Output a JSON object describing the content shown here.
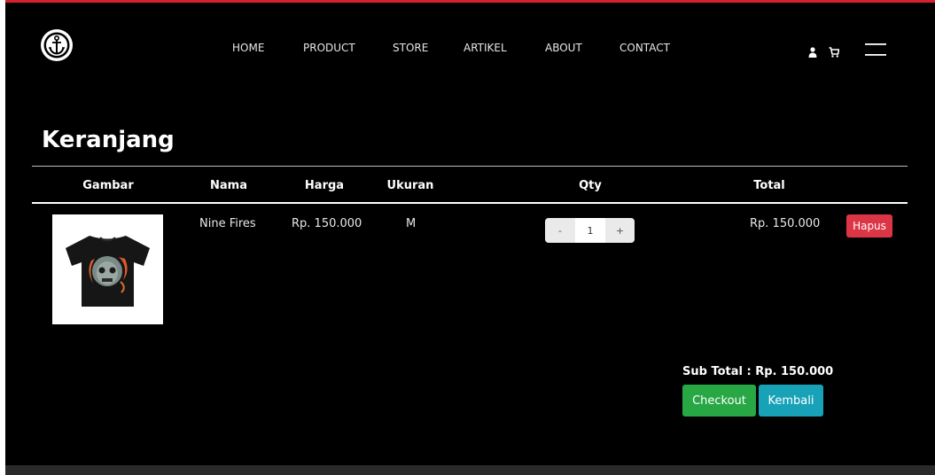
{
  "nav": {
    "links": [
      "HOME",
      "PRODUCT",
      "STORE",
      "ARTIKEL",
      "ABOUT",
      "CONTACT"
    ],
    "icons": [
      "anchor-logo",
      "user-icon",
      "cart-icon",
      "menu-icon"
    ]
  },
  "cart": {
    "title": "Keranjang",
    "headers": {
      "gambar": "Gambar",
      "nama": "Nama",
      "harga": "Harga",
      "ukuran": "Ukuran",
      "qty": "Qty",
      "total": "Total"
    },
    "item": {
      "nama": "Nine Fires",
      "harga": "Rp. 150.000",
      "ukuran": "M",
      "qty_minus": "-",
      "qty_value": "1",
      "qty_plus": "+",
      "total": "Rp. 150.000",
      "hapus_label": "Hapus"
    },
    "subtotal": "Sub Total : Rp. 150.000",
    "checkout_label": "Checkout",
    "kembali_label": "Kembali"
  },
  "colors": {
    "accent_top": "#d8202e",
    "hapus": "#dc3545",
    "checkout": "#28a745",
    "kembali": "#17a2b8"
  }
}
